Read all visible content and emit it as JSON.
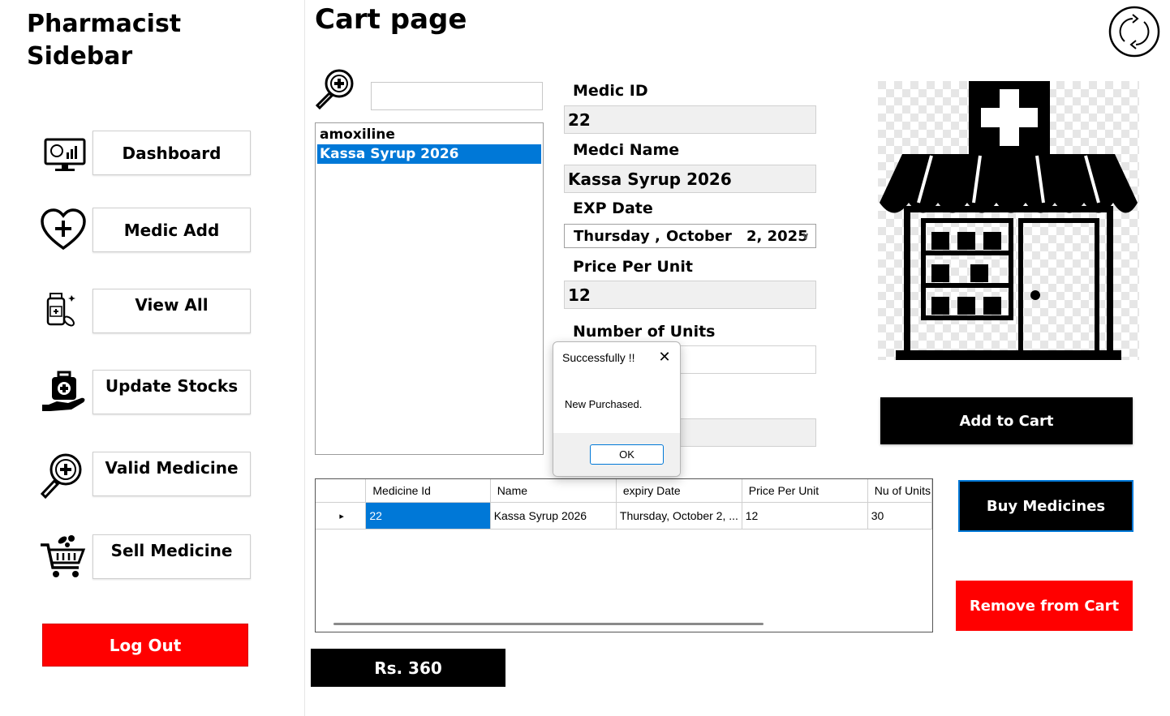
{
  "sidebar": {
    "title_line1": "Pharmacist",
    "title_line2": "Sidebar",
    "items": [
      {
        "label": "Dashboard",
        "icon": "dashboard-monitor-icon"
      },
      {
        "label": "Medic Add",
        "icon": "heart-plus-icon"
      },
      {
        "label": "View All",
        "icon": "medicine-bottle-icon"
      },
      {
        "label": "Update Stocks",
        "icon": "medical-bag-hand-icon"
      },
      {
        "label": "Valid Medicine",
        "icon": "magnifier-plus-icon"
      },
      {
        "label": "Sell Medicine",
        "icon": "shopping-cart-pills-icon"
      }
    ],
    "logout_label": "Log Out"
  },
  "main": {
    "title": "Cart page",
    "search": {
      "value": "",
      "placeholder": ""
    },
    "list_items": [
      "amoxiline",
      "Kassa Syrup 2026"
    ],
    "selected_item": "Kassa Syrup 2026",
    "fields": {
      "medic_id_label": "Medic ID",
      "medic_id_value": "22",
      "medic_name_label": "Medci Name",
      "medic_name_value": "Kassa Syrup 2026",
      "exp_date_label": "EXP Date",
      "exp_date_day": "Thursday ,",
      "exp_date_month": "October",
      "exp_date_rest": "2, 2025",
      "price_label": "Price Per Unit",
      "price_value": "12",
      "units_label": "Number of Units",
      "units_value": "",
      "hidden_value": ""
    },
    "buttons": {
      "add_to_cart": "Add to Cart",
      "buy_medicines": "Buy Medicines",
      "remove_from_cart": "Remove from Cart"
    },
    "grid": {
      "columns": [
        "Medicine Id",
        "Name",
        "expiry Date",
        "Price Per Unit",
        "Nu of Units"
      ],
      "rows": [
        [
          "22",
          "Kassa Syrup 2026",
          "Thursday, October 2, ...",
          "12",
          "30"
        ]
      ]
    },
    "total": "Rs. 360"
  },
  "dialog": {
    "title": "Successfully !!",
    "message": "New Purchased.",
    "ok_label": "OK"
  },
  "colors": {
    "accent_blue": "#0078d7",
    "danger_red": "#ff0000",
    "black": "#000000"
  }
}
